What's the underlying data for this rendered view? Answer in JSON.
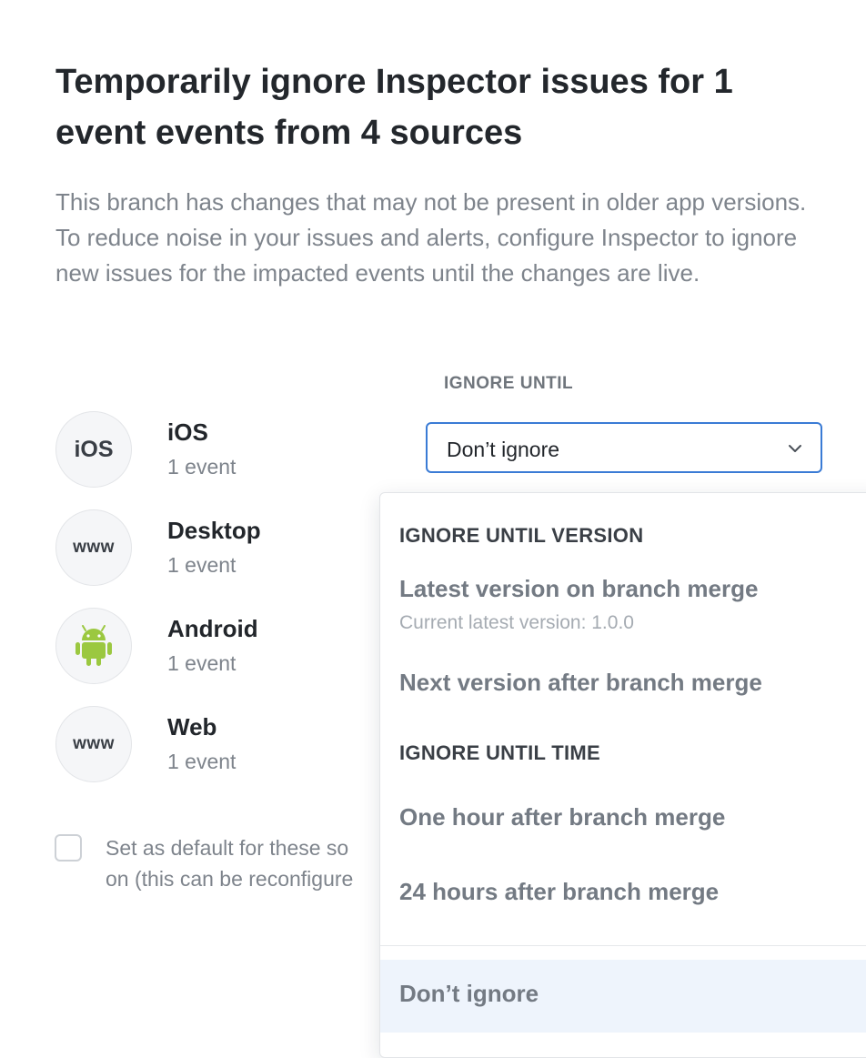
{
  "modal": {
    "title": "Temporarily ignore Inspector issues for 1 event events from 4 sources",
    "description": "This branch has changes that may not be present in older app versions. To reduce noise in your issues and alerts, configure Inspector to ignore new issues for the impacted events until the changes are live.",
    "column_label": "IGNORE UNTIL"
  },
  "sources": [
    {
      "avatar_text": "iOS",
      "name": "iOS",
      "count": "1 event"
    },
    {
      "avatar_text": "www",
      "name": "Desktop",
      "count": "1 event"
    },
    {
      "avatar_text": "",
      "icon": "android-icon",
      "name": "Android",
      "count": "1 event"
    },
    {
      "avatar_text": "www",
      "name": "Web",
      "count": "1 event"
    }
  ],
  "select": {
    "value": "Don’t ignore",
    "icon": "chevron-down-icon"
  },
  "dropdown": {
    "group_version": "IGNORE UNTIL VERSION",
    "latest_version": "Latest version on branch merge",
    "latest_version_sub": "Current latest version: 1.0.0",
    "next_version": "Next version after branch merge",
    "group_time": "IGNORE UNTIL TIME",
    "one_hour": "One hour after branch merge",
    "twentyfour_hours": "24 hours after branch merge",
    "dont_ignore": "Don’t ignore"
  },
  "default_checkbox": {
    "line1": "Set as default for these so",
    "line2": "on (this can be reconfigure"
  },
  "colors": {
    "accent": "#3a7bd5",
    "android_green": "#9bc840",
    "selected_bg": "#eef4fc"
  }
}
